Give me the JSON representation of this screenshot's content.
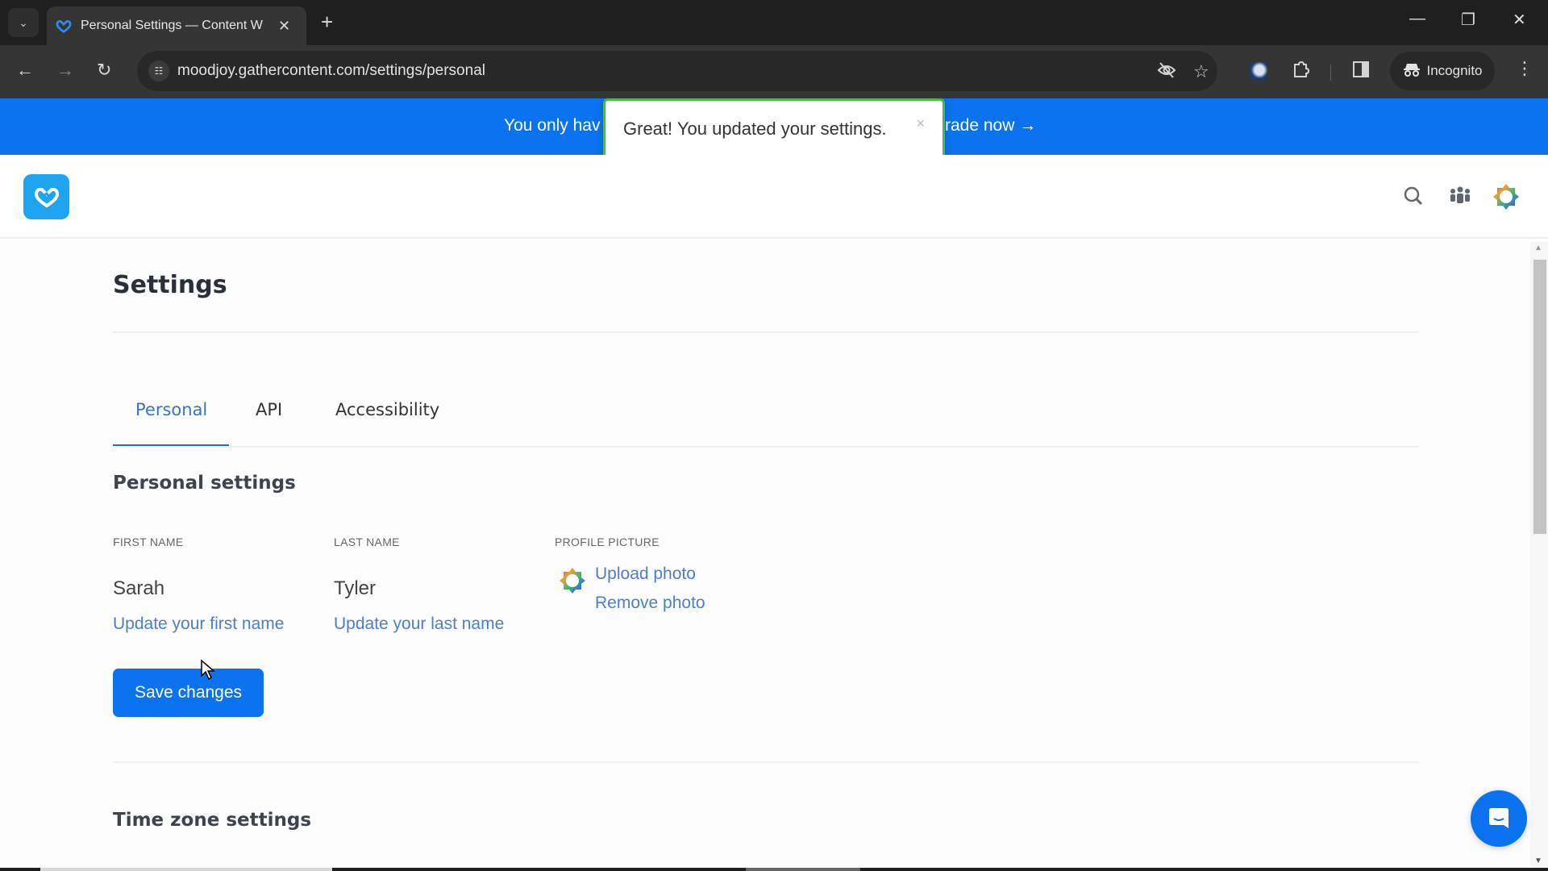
{
  "browser": {
    "tab_title": "Personal Settings — Content W",
    "url": "moodjoy.gathercontent.com/settings/personal",
    "incognito_label": "Incognito",
    "icons": {
      "tab_search": "chevron-down-icon",
      "close_tab": "close-icon",
      "new_tab": "plus-icon",
      "back": "arrow-left-icon",
      "forward": "arrow-right-icon",
      "reload": "reload-icon",
      "site_info": "tune-icon",
      "tracking": "eye-off-icon",
      "bookmark": "star-icon",
      "extensions": "puzzle-icon",
      "side_panel": "side-panel-icon",
      "menu": "kebab-menu-icon"
    }
  },
  "banner": {
    "text_visible": "You only hav",
    "link_visible": "rade now →",
    "color": "#0b73f0"
  },
  "toast": {
    "message": "Great! You updated your settings.",
    "close": "×",
    "border_color": "#4cb84a"
  },
  "header": {
    "icons": [
      "search-icon",
      "team-icon",
      "user-avatar-icon"
    ]
  },
  "page": {
    "title": "Settings",
    "tabs": [
      {
        "label": "Personal",
        "active": true
      },
      {
        "label": "API",
        "active": false
      },
      {
        "label": "Accessibility",
        "active": false
      }
    ],
    "personal": {
      "section_title": "Personal settings",
      "first_name_label": "FIRST NAME",
      "first_name_value": "Sarah",
      "first_name_link": "Update your first name",
      "last_name_label": "LAST NAME",
      "last_name_value": "Tyler",
      "last_name_link": "Update your last name",
      "profile_picture_label": "PROFILE PICTURE",
      "upload_photo": "Upload photo",
      "remove_photo": "Remove photo",
      "save_label": "Save changes"
    },
    "timezone": {
      "section_title": "Time zone settings"
    }
  },
  "colors": {
    "primary": "#0b73f0",
    "link": "#4a7fcb",
    "active_tab": "#3b73c7",
    "logo": "#1fa4f2"
  }
}
